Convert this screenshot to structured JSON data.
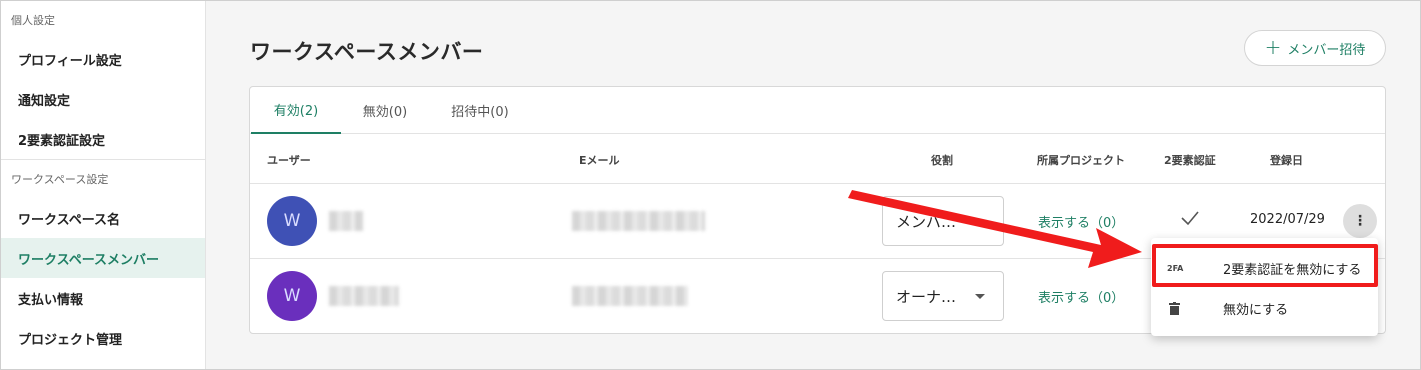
{
  "sidebar": {
    "personal_section": "個人設定",
    "personal_items": [
      "プロフィール設定",
      "通知設定",
      "2要素認証設定"
    ],
    "workspace_section": "ワークスペース設定",
    "workspace_items": [
      "ワークスペース名",
      "ワークスペースメンバー",
      "支払い情報",
      "プロジェクト管理"
    ],
    "active_item": "ワークスペースメンバー"
  },
  "page": {
    "title": "ワークスペースメンバー",
    "invite_label": "メンバー招待"
  },
  "tabs": [
    "有効(2)",
    "無効(0)",
    "招待中(0)"
  ],
  "table": {
    "headers": {
      "user": "ユーザー",
      "email": "Eメール",
      "role": "役割",
      "projects": "所属プロジェクト",
      "two_factor": "2要素認証",
      "registered": "登録日"
    },
    "rows": [
      {
        "avatar_letter": "W",
        "avatar_color": "#3f51b5",
        "role": "メンバ…",
        "projects_link": "表示する（0）",
        "two_factor_enabled": true,
        "registered": "2022/07/29"
      },
      {
        "avatar_letter": "W",
        "avatar_color": "#6a2fbd",
        "role": "オーナ…",
        "projects_link": "表示する（0）"
      }
    ]
  },
  "menu": {
    "disable_2fa_icon": "2FA",
    "disable_2fa_label": "2要素認証を無効にする",
    "deactivate_label": "無効にする"
  },
  "colors": {
    "accent": "#1e7f64",
    "annotation": "#f01c1c"
  }
}
